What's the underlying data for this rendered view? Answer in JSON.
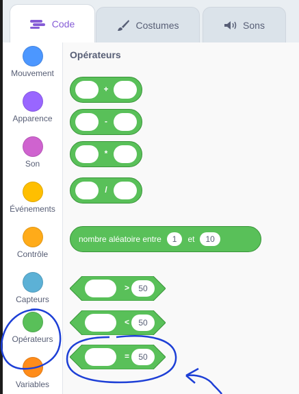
{
  "tabs": [
    {
      "label": "Code",
      "icon": "code-icon"
    },
    {
      "label": "Costumes",
      "icon": "paintbrush-icon"
    },
    {
      "label": "Sons",
      "icon": "speaker-icon"
    }
  ],
  "categories": [
    {
      "label": "Mouvement",
      "color": "#4c97ff"
    },
    {
      "label": "Apparence",
      "color": "#9966ff"
    },
    {
      "label": "Son",
      "color": "#cf63cf"
    },
    {
      "label": "Événements",
      "color": "#ffbf00"
    },
    {
      "label": "Contrôle",
      "color": "#ffab19"
    },
    {
      "label": "Capteurs",
      "color": "#5cb1d6"
    },
    {
      "label": "Opérateurs",
      "color": "#59c059"
    },
    {
      "label": "Variables",
      "color": "#ff8c1a"
    }
  ],
  "palette": {
    "title": "Opérateurs",
    "arith": [
      "+",
      "-",
      "*",
      "/"
    ],
    "random": {
      "text": "nombre aléatoire entre",
      "from": "1",
      "and": "et",
      "to": "10"
    },
    "compare": [
      {
        "op": ">",
        "value": "50"
      },
      {
        "op": "<",
        "value": "50"
      },
      {
        "op": "=",
        "value": "50"
      }
    ]
  },
  "colors": {
    "operators": "#59c059",
    "annotation": "#1d3fd6"
  }
}
